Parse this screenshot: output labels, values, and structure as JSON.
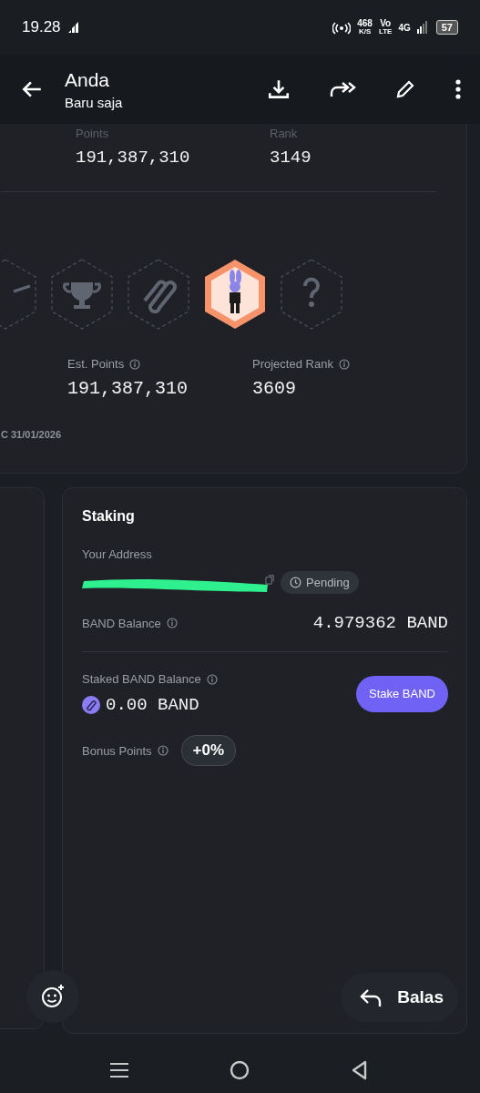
{
  "status_bar": {
    "time": "19.28",
    "speed": "468",
    "speed_unit": "K/S",
    "volte_top": "Vo",
    "volte_bottom": "LTE",
    "network": "4G",
    "battery": "57"
  },
  "app_bar": {
    "title": "Anda",
    "subtitle": "Baru saja"
  },
  "summary": {
    "stats": [
      {
        "label": "Points",
        "value": "191,387,310"
      },
      {
        "label": "Rank",
        "value": "3149"
      }
    ],
    "badges": [
      {
        "kind": "cut",
        "earned": false
      },
      {
        "kind": "trophy",
        "earned": false
      },
      {
        "kind": "band",
        "earned": false
      },
      {
        "kind": "rabbit",
        "earned": true
      },
      {
        "kind": "unknown",
        "earned": false
      }
    ],
    "estimates": [
      {
        "label": "Est. Points",
        "value": "191,387,310"
      },
      {
        "label": "Projected Rank",
        "value": "3609"
      }
    ],
    "footnote": "C 31/01/2026"
  },
  "staking": {
    "title": "Staking",
    "address_label": "Your Address",
    "status": "Pending",
    "balance_label": "BAND Balance",
    "balance": "4.979362 BAND",
    "staked_label": "Staked BAND Balance",
    "staked": "0.00 BAND",
    "stake_button": "Stake BAND",
    "bonus_label": "Bonus Points",
    "bonus": "+0%"
  },
  "reply_button": "Balas"
}
